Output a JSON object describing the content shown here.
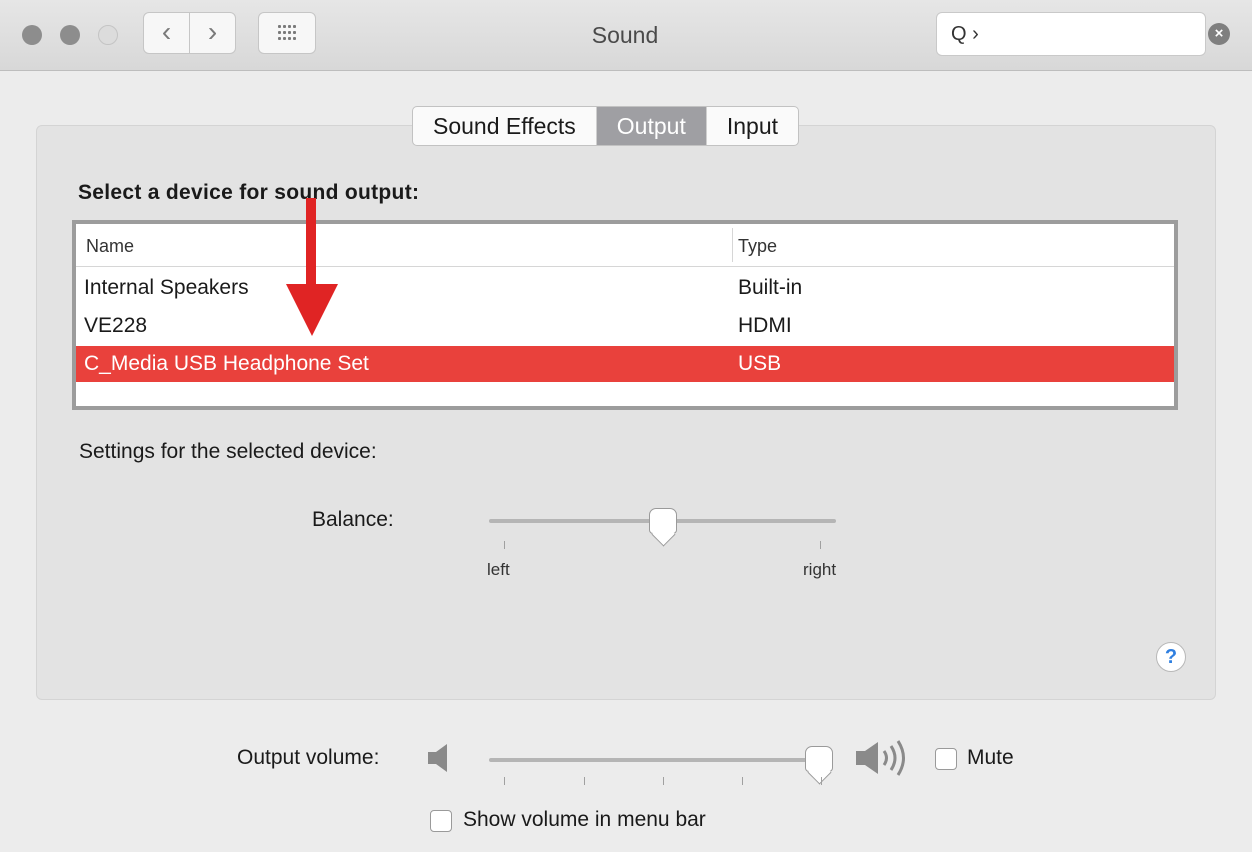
{
  "window": {
    "title": "Sound",
    "search": {
      "value": "Q ›"
    }
  },
  "toolbar": {
    "back_glyph": "‹",
    "forward_glyph": "›",
    "icons": [
      "close-traffic-light-icon",
      "minimize-traffic-light-icon",
      "zoom-traffic-light-icon",
      "back-chevron-icon",
      "forward-chevron-icon",
      "show-all-grid-icon",
      "search-icon",
      "clear-search-icon"
    ]
  },
  "tabs": [
    {
      "label": "Sound Effects",
      "active": false
    },
    {
      "label": "Output",
      "active": true
    },
    {
      "label": "Input",
      "active": false
    }
  ],
  "device_list": {
    "heading": "Select a device for sound output:",
    "columns": [
      "Name",
      "Type"
    ],
    "rows": [
      {
        "name": "Internal Speakers",
        "type": "Built-in",
        "selected": false
      },
      {
        "name": "VE228",
        "type": "HDMI",
        "selected": false
      },
      {
        "name": "C_Media USB Headphone Set",
        "type": "USB",
        "selected": true
      }
    ]
  },
  "settings": {
    "label": "Settings for the selected device:",
    "balance": {
      "label": "Balance:",
      "left_label": "left",
      "right_label": "right",
      "value": 0.5
    }
  },
  "help_label": "?",
  "volume": {
    "label": "Output volume:",
    "level": 0.97,
    "mute_label": "Mute",
    "mute_checked": false,
    "menu_bar_label": "Show volume in menu bar",
    "menu_bar_checked": false
  },
  "colors": {
    "selection": "#e9413c",
    "annotation_arrow": "#e02424",
    "active_tab": "#9f9fa3",
    "help_accent": "#2f7fe0"
  }
}
